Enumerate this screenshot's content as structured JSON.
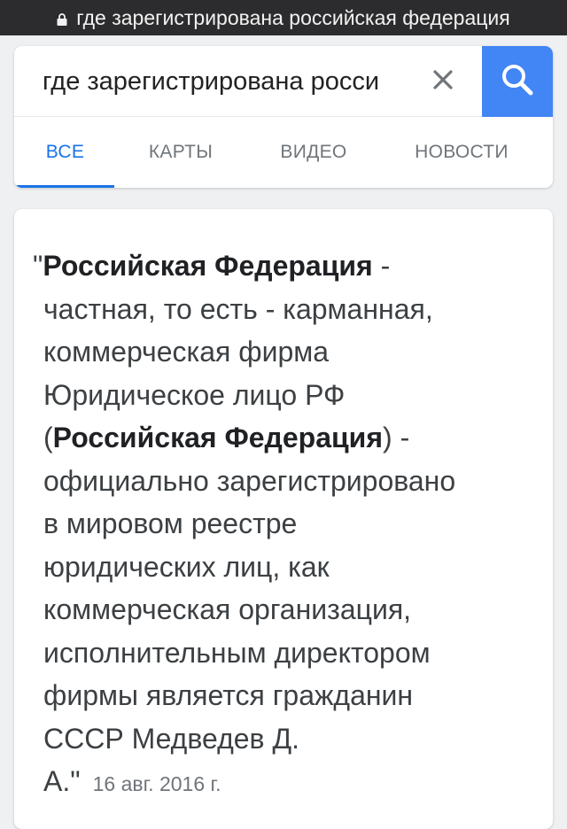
{
  "url_bar": {
    "text": "где зарегистрирована российская федерация"
  },
  "search": {
    "query": "где зарегистрирована росси",
    "clear_icon": "close-icon",
    "search_icon": "search-icon"
  },
  "tabs": [
    {
      "label": "ВСЕ",
      "active": true
    },
    {
      "label": "КАРТЫ",
      "active": false
    },
    {
      "label": "ВИДЕО",
      "active": false
    },
    {
      "label": "НОВОСТИ",
      "active": false
    }
  ],
  "result": {
    "l1_quote": "\"",
    "l1_bold": "Российская Федерация",
    "l1_rest": " -",
    "l2": "частная, то есть - карманная,",
    "l3": "коммерческая фирма",
    "l4": "Юридическое лицо РФ",
    "l5_open": "(",
    "l5_bold": "Российская Федерация",
    "l5_rest": ") -",
    "l6": "официально зарегистрировано",
    "l7": "в мировом реестре",
    "l8": "юридических лиц, как",
    "l9": "коммерческая организация,",
    "l10": "исполнительным директором",
    "l11": "фирмы является гражданин",
    "l12": "СССР Медведев Д.",
    "l13": "А.\"",
    "date": "16 авг. 2016 г."
  },
  "colors": {
    "accent": "#1a73e8",
    "search_button": "#4285f4",
    "url_bar_bg": "#2c2c2e"
  }
}
